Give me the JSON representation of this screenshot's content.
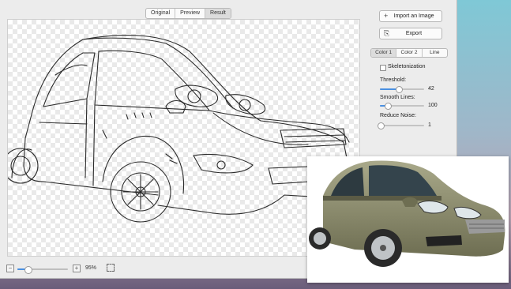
{
  "view_tabs": [
    {
      "label": "Original",
      "active": false
    },
    {
      "label": "Preview",
      "active": false
    },
    {
      "label": "Result",
      "active": true
    }
  ],
  "panel": {
    "import_label": "Import an Image",
    "export_label": "Export",
    "color_tabs": [
      {
        "label": "Color 1",
        "active": true
      },
      {
        "label": "Color 2",
        "active": false
      },
      {
        "label": "Line",
        "active": false
      }
    ],
    "skeleton_label": "Skeletonization",
    "skeleton_checked": false,
    "threshold": {
      "label": "Threshold:",
      "value": "42",
      "fraction": 0.42
    },
    "smooth": {
      "label": "Smooth Lines:",
      "value": "100",
      "fraction": 0.18
    },
    "noise": {
      "label": "Reduce Noise:",
      "value": "1",
      "fraction": 0.02
    }
  },
  "zoom": {
    "value": "95%",
    "fraction": 0.2
  },
  "icons": {
    "zoom_out": "zoom-out-icon",
    "zoom_in": "zoom-in-icon",
    "fit": "fit-to-window-icon",
    "import": "plus-icon",
    "export": "export-icon"
  },
  "colors": {
    "accent": "#4a90e2",
    "car_body": "#8a8a68"
  }
}
